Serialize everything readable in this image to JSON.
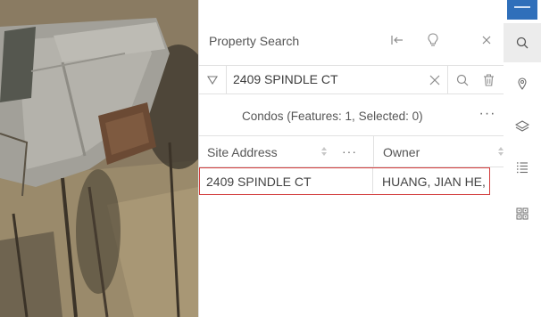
{
  "panel": {
    "title": "Property Search",
    "icons": [
      "collapse-panel-icon",
      "lightbulb-icon",
      "close-icon"
    ]
  },
  "search": {
    "value": "2409 SPINDLE CT",
    "icons": [
      "filter-icon",
      "clear-icon",
      "search-icon",
      "delete-icon"
    ]
  },
  "layer": {
    "title": "Condos (Features: 1, Selected: 0)",
    "more": "···"
  },
  "table": {
    "columns": [
      {
        "label": "Site Address"
      },
      {
        "label": "Owner"
      }
    ],
    "more": "···",
    "rows": [
      {
        "site_address": "2409 SPINDLE CT",
        "owner": "HUANG, JIAN HE, CHI"
      }
    ]
  },
  "rail": {
    "icons": [
      "search-icon",
      "location-pin-icon",
      "layers-icon",
      "list-icon",
      "qr-grid-icon"
    ],
    "accent_color": "#2f6fba"
  }
}
